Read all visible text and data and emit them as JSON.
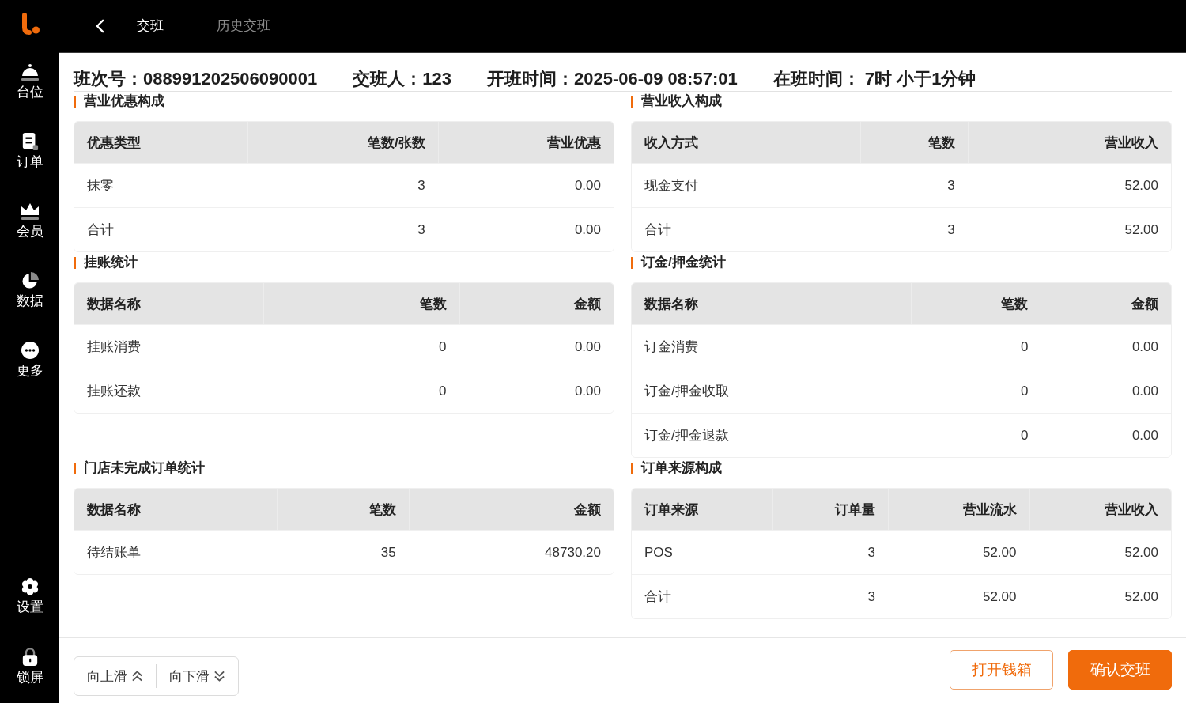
{
  "sidebar": {
    "items": [
      {
        "label": "台位"
      },
      {
        "label": "订单"
      },
      {
        "label": "会员"
      },
      {
        "label": "数据"
      },
      {
        "label": "更多"
      }
    ],
    "bottom_items": [
      {
        "label": "设置"
      },
      {
        "label": "锁屏"
      }
    ]
  },
  "tabs": [
    {
      "label": "交班",
      "selected": true
    },
    {
      "label": "历史交班",
      "selected": false
    }
  ],
  "shift_info": [
    "班次号：088991202506090001",
    "交班人：123",
    "开班时间：2025-06-09 08:57:01",
    "在班时间： 7时 小于1分钟"
  ],
  "sections": [
    {
      "title": "营业优惠构成",
      "columns": [
        "优惠类型",
        "笔数/张数",
        "营业优惠"
      ],
      "rows": [
        [
          "抹零",
          "3",
          "0.00"
        ],
        [
          "合计",
          "3",
          "0.00"
        ]
      ]
    },
    {
      "title": "营业收入构成",
      "columns": [
        "收入方式",
        "笔数",
        "营业收入"
      ],
      "rows": [
        [
          "现金支付",
          "3",
          "52.00"
        ],
        [
          "合计",
          "3",
          "52.00"
        ]
      ]
    },
    {
      "title": "挂账统计",
      "columns": [
        "数据名称",
        "笔数",
        "金额"
      ],
      "rows": [
        [
          "挂账消费",
          "0",
          "0.00"
        ],
        [
          "挂账还款",
          "0",
          "0.00"
        ]
      ]
    },
    {
      "title": "订金/押金统计",
      "columns": [
        "数据名称",
        "笔数",
        "金额"
      ],
      "rows": [
        [
          "订金消费",
          "0",
          "0.00"
        ],
        [
          "订金/押金收取",
          "0",
          "0.00"
        ],
        [
          "订金/押金退款",
          "0",
          "0.00"
        ]
      ]
    },
    {
      "title": "门店未完成订单统计",
      "columns": [
        "数据名称",
        "笔数",
        "金额"
      ],
      "rows": [
        [
          "待结账单",
          "35",
          "48730.20"
        ]
      ]
    },
    {
      "title": "订单来源构成",
      "columns": [
        "订单来源",
        "订单量",
        "营业流水",
        "营业收入"
      ],
      "rows": [
        [
          "POS",
          "3",
          "52.00",
          "52.00"
        ],
        [
          "合计",
          "3",
          "52.00",
          "52.00"
        ]
      ]
    }
  ],
  "footer": {
    "scroll_buttons": [
      {
        "label": "向上滑"
      },
      {
        "label": "向下滑"
      }
    ],
    "actions": [
      {
        "label": "打开钱箱",
        "kind": "outline"
      },
      {
        "label": "确认交班",
        "kind": "primary"
      }
    ]
  }
}
